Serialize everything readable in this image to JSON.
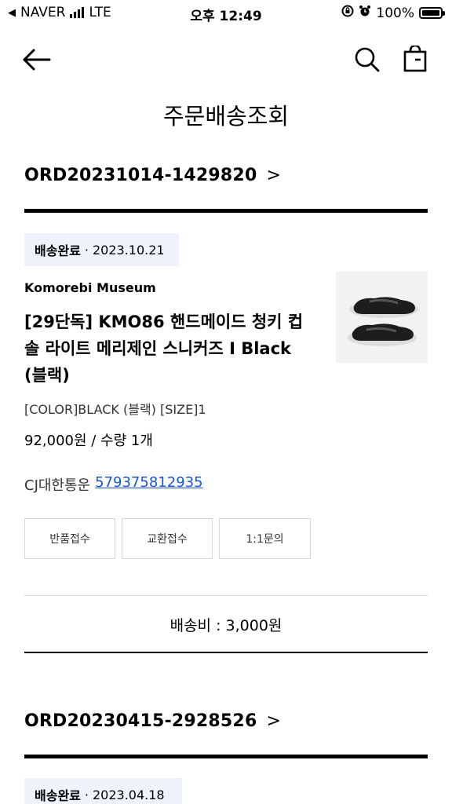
{
  "status_bar": {
    "carrier": "NAVER",
    "network": "LTE",
    "time": "오후 12:49",
    "battery": "100%"
  },
  "header": {
    "title": "주문배송조회"
  },
  "orders": [
    {
      "order_number": "ORD20231014-1429820",
      "chevron": ">",
      "status": "배송완료",
      "separator": "·",
      "date": "2023.10.21",
      "brand": "Komorebi Museum",
      "product_name": "[29단독] KMO86 핸드메이드 청키 컵 솔 라이트 메리제인 스니커즈 I Black (블랙)",
      "option": "[COLOR]BLACK (블랙) [SIZE]1",
      "price_qty": "92,000원 / 수량 1개",
      "courier": "CJ대한통운",
      "tracking_number": "579375812935",
      "actions": [
        "반품접수",
        "교환접수",
        "1:1문의"
      ],
      "shipping_fee": "배송비 : 3,000원"
    },
    {
      "order_number": "ORD20230415-2928526",
      "chevron": ">",
      "status": "배송완료",
      "separator": "·",
      "date": "2023.04.18"
    }
  ]
}
